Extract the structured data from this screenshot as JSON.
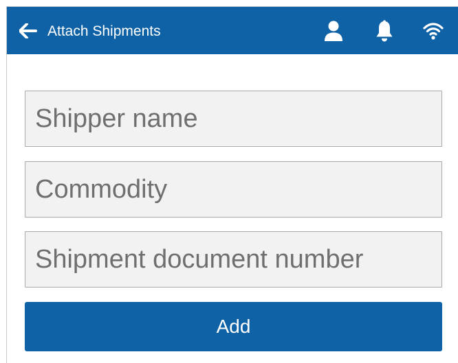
{
  "header": {
    "title": "Attach Shipments",
    "background": "#0f62a6",
    "icons": [
      "back-arrow-icon",
      "user-icon",
      "bell-icon",
      "wifi-icon"
    ]
  },
  "form": {
    "shipper_name": {
      "placeholder": "Shipper name",
      "value": ""
    },
    "commodity": {
      "placeholder": "Commodity",
      "value": ""
    },
    "shipment_document_number": {
      "placeholder": "Shipment document number",
      "value": ""
    },
    "add_label": "Add",
    "accent": "#0f62a6",
    "field_background": "#f2f2f2"
  }
}
